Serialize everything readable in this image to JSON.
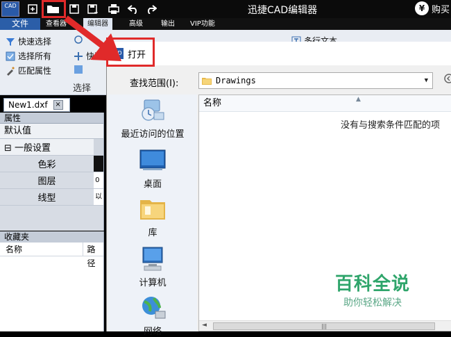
{
  "app": {
    "title": "迅捷CAD编辑器",
    "logo_text": "CAD",
    "buy_label": "购买",
    "buy_icon": "yen-icon"
  },
  "ribbon_tabs": [
    {
      "label": "文件"
    },
    {
      "label": "查看器"
    },
    {
      "label": "编辑器"
    },
    {
      "label": "高级"
    },
    {
      "label": "输出"
    },
    {
      "label": "VIP功能"
    }
  ],
  "ribbon": {
    "quick_select": "快速选择",
    "select_all": "选择所有",
    "match_props": "匹配属性",
    "col2_row2": "快速",
    "group_label": "选择",
    "multiline_text": "多行文本"
  },
  "document": {
    "tab": "New1.dxf",
    "tab_close": "×"
  },
  "properties": {
    "header": "属性",
    "default": "默认值",
    "section": "一般设置",
    "section_toggle": "⊟",
    "rows": [
      {
        "label": "色彩",
        "value": ""
      },
      {
        "label": "图层",
        "value": "0"
      },
      {
        "label": "线型",
        "value": "以"
      }
    ]
  },
  "favorites": {
    "header": "收藏夹",
    "col_name": "名称",
    "col_path": "路径"
  },
  "dialog": {
    "title": "打开",
    "look_in_label": "查找范围(I):",
    "look_in_value": "Drawings",
    "places": [
      {
        "label": "最近访问的位置",
        "icon": "recent-places-icon"
      },
      {
        "label": "桌面",
        "icon": "desktop-icon"
      },
      {
        "label": "库",
        "icon": "library-icon"
      },
      {
        "label": "计算机",
        "icon": "computer-icon"
      },
      {
        "label": "网络",
        "icon": "network-icon"
      }
    ],
    "column_name": "名称",
    "empty_message": "没有与搜索条件匹配的项",
    "scroll_thumb": "|||"
  },
  "annotations": {
    "highlight_color": "#e02a2a"
  },
  "watermark": {
    "big": "百科全说",
    "small": "助你轻松解决"
  },
  "colors": {
    "accent": "#2b5ea8",
    "titlebar": "#0b0b0b",
    "watermark": "#2fa56b"
  }
}
